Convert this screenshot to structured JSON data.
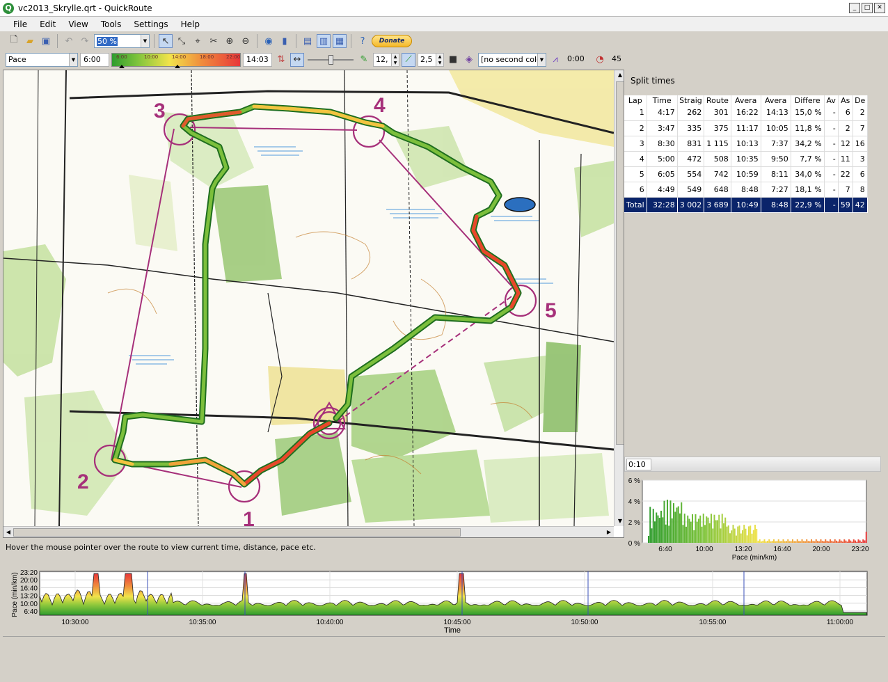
{
  "window": {
    "title": "vc2013_Skrylle.qrt - QuickRoute",
    "app_icon": "Q"
  },
  "menu": [
    "File",
    "Edit",
    "View",
    "Tools",
    "Settings",
    "Help"
  ],
  "toolbar": {
    "zoom_value": "50 %",
    "donate_label": "Donate",
    "color_mode": "Pace",
    "low_value": "6:00",
    "gradient_ticks": [
      "6:00",
      "10:00",
      "14:00",
      "18:00",
      "22:00"
    ],
    "high_value": "14:03",
    "width_value": "12,",
    "border_value": "2,5",
    "second_color": "[no second color",
    "smoothing_value": "0:00",
    "speed_value": "45"
  },
  "map": {
    "controls": [
      "1",
      "2",
      "3",
      "4",
      "5"
    ],
    "accent_purple": "#a6307a"
  },
  "status_text": "Hover the mouse pointer over the route to view current time, distance, pace etc.",
  "split_times": {
    "title": "Split times",
    "headers": [
      "Lap",
      "Time",
      "Straig",
      "Route",
      "Avera",
      "Avera",
      "Differe",
      "Av",
      "As",
      "De"
    ],
    "rows": [
      [
        "1",
        "4:17",
        "262",
        "301",
        "16:22",
        "14:13",
        "15,0 %",
        "-",
        "6",
        "2"
      ],
      [
        "2",
        "3:47",
        "335",
        "375",
        "11:17",
        "10:05",
        "11,8 %",
        "-",
        "2",
        "7"
      ],
      [
        "3",
        "8:30",
        "831",
        "1 115",
        "10:13",
        "7:37",
        "34,2 %",
        "-",
        "12",
        "16"
      ],
      [
        "4",
        "5:00",
        "472",
        "508",
        "10:35",
        "9:50",
        "7,7 %",
        "-",
        "11",
        "3"
      ],
      [
        "5",
        "6:05",
        "554",
        "742",
        "10:59",
        "8:11",
        "34,0 %",
        "-",
        "22",
        "6"
      ],
      [
        "6",
        "4:49",
        "549",
        "648",
        "8:48",
        "7:27",
        "18,1 %",
        "-",
        "7",
        "8"
      ]
    ],
    "total": [
      "Total",
      "32:28",
      "3 002",
      "3 689",
      "10:49",
      "8:48",
      "22,9 %",
      "-",
      "59",
      "42"
    ]
  },
  "histogram": {
    "interval_label": "0:10",
    "y_ticks": [
      "6 %",
      "4 %",
      "2 %",
      "0 %"
    ],
    "x_ticks": [
      "6:40",
      "10:00",
      "13:20",
      "16:40",
      "20:00",
      "23:20"
    ],
    "x_label": "Pace (min/km)"
  },
  "time_graph": {
    "y_label": "Pace (min/km)",
    "y_ticks": [
      "23:20",
      "20:00",
      "16:40",
      "13:20",
      "10:00",
      "6:40"
    ],
    "x_ticks": [
      "10:30:00",
      "10:35:00",
      "10:40:00",
      "10:45:00",
      "10:50:00",
      "10:55:00",
      "11:00:00"
    ],
    "x_label": "Time"
  }
}
